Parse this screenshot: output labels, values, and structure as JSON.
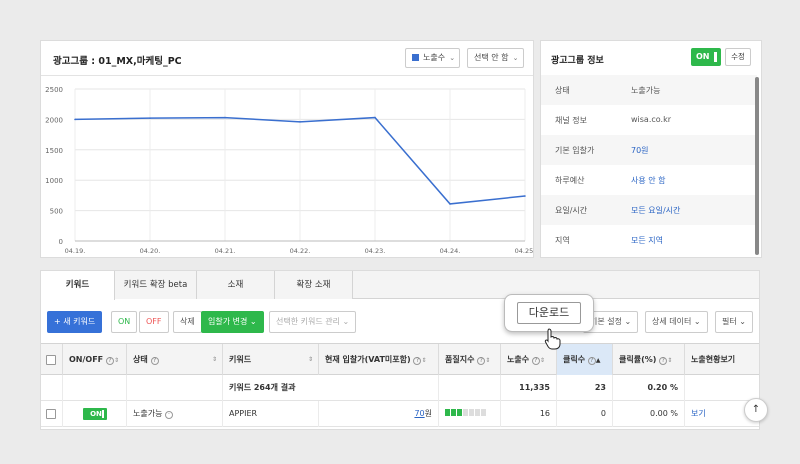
{
  "chart_panel": {
    "title": "광고그룹 : 01_MX,마케팅_PC",
    "metric_select": "노출수",
    "compare_select": "선택 안 함"
  },
  "chart_data": {
    "type": "line",
    "x": [
      "04.19.",
      "04.20.",
      "04.21.",
      "04.22.",
      "04.23.",
      "04.24.",
      "04.25."
    ],
    "series": [
      {
        "values": [
          2000,
          2020,
          2030,
          1960,
          2030,
          610,
          740
        ]
      }
    ],
    "ylim": [
      0,
      2500
    ],
    "yticks": [
      0,
      500,
      1000,
      1500,
      2000,
      2500
    ],
    "grid": true,
    "color": "#3a6fcf"
  },
  "info_panel": {
    "title": "광고그룹 정보",
    "toggle": "ON",
    "edit": "수정",
    "rows": [
      {
        "key": "상태",
        "value": "노출가능"
      },
      {
        "key": "채널 정보",
        "value": "wisa.co.kr"
      },
      {
        "key": "기본 입찰가",
        "value": "70원"
      },
      {
        "key": "하루예산",
        "value": "사용 안 함"
      },
      {
        "key": "요일/시간",
        "value": "모든 요일/시간"
      },
      {
        "key": "지역",
        "value": "모든 지역"
      }
    ]
  },
  "tabs": [
    "키워드",
    "키워드 확장 beta",
    "소재",
    "확장 소재"
  ],
  "toolbar": {
    "new_keyword": "+ 새 키워드",
    "on": "ON",
    "off": "OFF",
    "delete": "삭제",
    "bid_change": "입찰가 변경",
    "manage": "선택한 키워드 관리",
    "download": "다운로드",
    "basic_settings": "기본 설정",
    "detail_data": "상세 데이터",
    "filter": "필터"
  },
  "columns": [
    "ON/OFF",
    "상태",
    "키워드",
    "현재 입찰가(VAT미포함)",
    "품질지수",
    "노출수",
    "클릭수",
    "클릭률(%)",
    "노출현황보기"
  ],
  "summary": {
    "label": "키워드 264개 결과",
    "impressions": "11,335",
    "clicks": "23",
    "ctr": "0.20 %"
  },
  "rows": [
    {
      "toggle": "ON",
      "status": "노출가능",
      "keyword": "APPIER",
      "bid": "70",
      "bid_unit": "원",
      "quality": 3,
      "impressions": "16",
      "clicks": "0",
      "ctr": "0.00 %",
      "view": "보기"
    }
  ],
  "icons": {
    "scroll_top": "arrow-up-icon",
    "cursor": "hand-pointer-icon"
  }
}
